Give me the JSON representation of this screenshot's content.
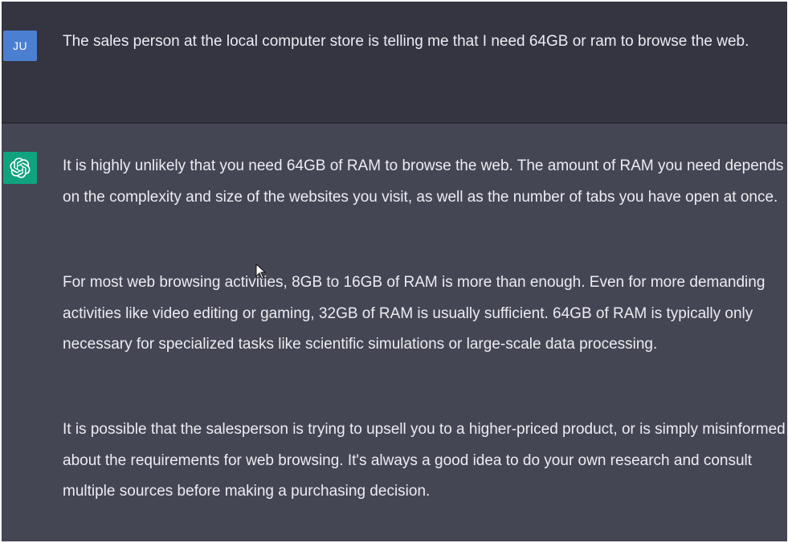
{
  "conversation": {
    "user_message": {
      "avatar_initials": "JU",
      "text": "The sales person at the local computer store is telling me that I need 64GB or ram to browse the web."
    },
    "assistant_message": {
      "avatar_icon": "openai-logo-icon",
      "paragraphs": [
        "It is highly unlikely that you need 64GB of RAM to browse the web. The amount of RAM you need depends on the complexity and size of the websites you visit, as well as the number of tabs you have open at once.",
        "For most web browsing activities, 8GB to 16GB of RAM is more than enough. Even for more demanding activities like video editing or gaming, 32GB of RAM is usually sufficient. 64GB of RAM is typically only necessary for specialized tasks like scientific simulations or large-scale data processing.",
        "It is possible that the salesperson is trying to upsell you to a higher-priced product, or is simply misinformed about the requirements for web browsing. It's always a good idea to do your own research and consult multiple sources before making a purchasing decision."
      ]
    }
  },
  "colors": {
    "user_bg": "#343541",
    "assistant_bg": "#444654",
    "text": "#ececf1",
    "assistant_avatar_bg": "#10a37f",
    "user_avatar_bg": "#4b7fd1"
  }
}
